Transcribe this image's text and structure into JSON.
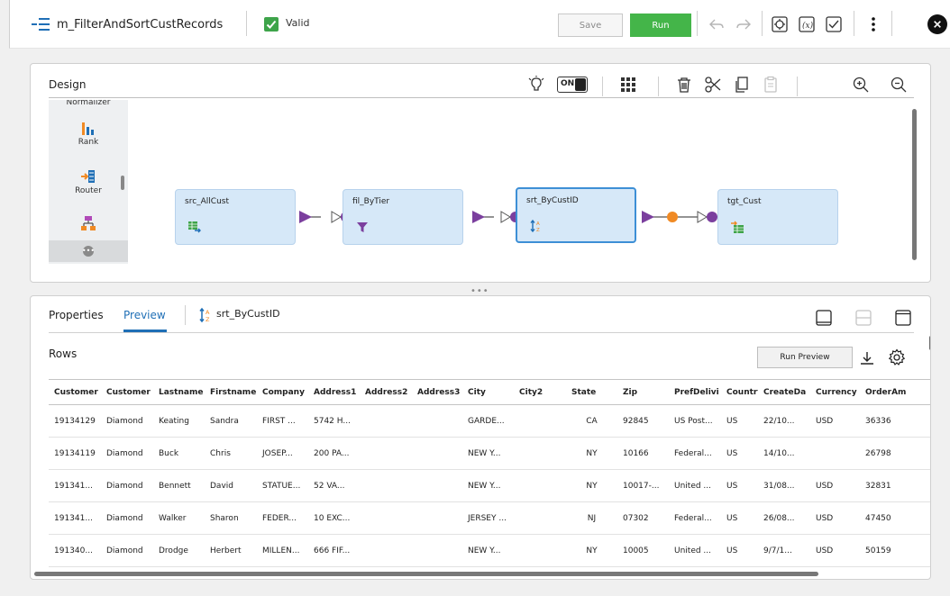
{
  "header": {
    "mapping_name": "m_FilterAndSortCustRecords",
    "status": "Valid",
    "save_label": "Save",
    "run_label": "Run",
    "icons": [
      "undo-icon",
      "redo-icon",
      "parameter-icon",
      "expression-icon",
      "validate-icon",
      "more-icon",
      "close-icon"
    ]
  },
  "design": {
    "title": "Design",
    "toggle_label": "ON",
    "palette": {
      "partial_label": "Normalizer",
      "items": [
        {
          "label": "Rank",
          "icon": "rank-icon"
        },
        {
          "label": "Router",
          "icon": "router-icon"
        },
        {
          "label": "",
          "icon": "hierarchy-icon"
        }
      ]
    },
    "nodes": [
      {
        "name": "src_AllCust",
        "icon": "source-icon"
      },
      {
        "name": "fil_ByTier",
        "icon": "filter-icon"
      },
      {
        "name": "srt_ByCustID",
        "icon": "sorter-icon"
      },
      {
        "name": "tgt_Cust",
        "icon": "target-icon"
      }
    ]
  },
  "bottom": {
    "tabs": [
      "Properties",
      "Preview"
    ],
    "active_tab": "Preview",
    "object_name": "srt_ByCustID",
    "rows_title": "Rows",
    "run_preview_label": "Run Preview",
    "columns": [
      "Customer",
      "Customer",
      "Lastname",
      "Firstname",
      "Company",
      "Address1",
      "Address2",
      "Address3",
      "City",
      "City2",
      "State",
      "Zip",
      "PrefDelivi",
      "Country",
      "CreateDa",
      "Currency",
      "OrderAm"
    ],
    "rows": [
      [
        "19134129",
        "Diamond",
        "Keating",
        "Sandra",
        "FIRST ...",
        "5742 H...",
        "",
        "",
        "GARDE...",
        "",
        "CA",
        "92845",
        "US Post...",
        "US",
        "22/10...",
        "USD",
        "36336"
      ],
      [
        "19134119",
        "Diamond",
        "Buck",
        "Chris",
        "JOSEP...",
        "200 PA...",
        "",
        "",
        "NEW Y...",
        "",
        "NY",
        "10166",
        "Federal...",
        "US",
        "14/10...",
        "",
        "26798"
      ],
      [
        "191341...",
        "Diamond",
        "Bennett",
        "David",
        "STATUE...",
        "52 VA...",
        "",
        "",
        "NEW Y...",
        "",
        "NY",
        "10017-...",
        "United ...",
        "US",
        "31/08...",
        "USD",
        "32831"
      ],
      [
        "191341...",
        "Diamond",
        "Walker",
        "Sharon",
        "FEDER...",
        "10 EXC...",
        "",
        "",
        "JERSEY ...",
        "",
        "NJ",
        "07302",
        "Federal...",
        "US",
        "26/08...",
        "USD",
        "47450"
      ],
      [
        "191340...",
        "Diamond",
        "Drodge",
        "Herbert",
        "MILLEN...",
        "666 FIF...",
        "",
        "",
        "NEW Y...",
        "",
        "NY",
        "10005",
        "United ...",
        "US",
        "9/7/1...",
        "USD",
        "50159"
      ]
    ]
  }
}
